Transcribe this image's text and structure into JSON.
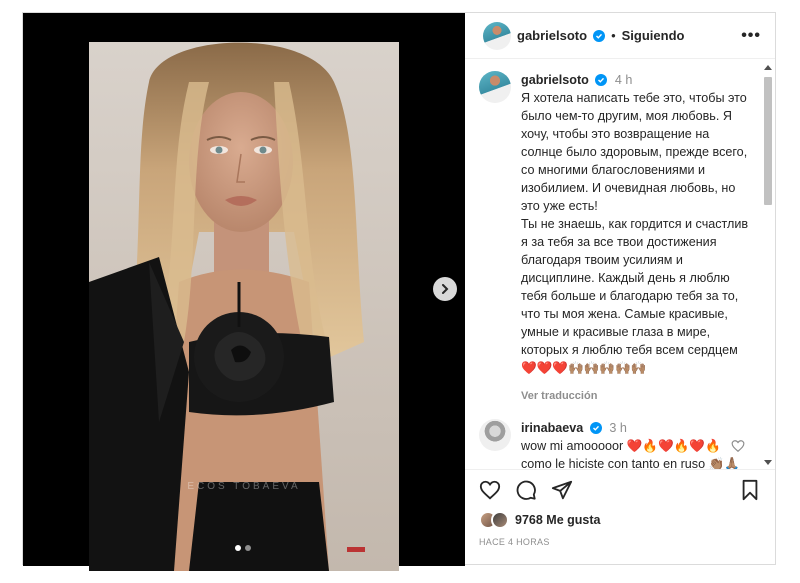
{
  "post": {
    "author": "gabrielsoto",
    "separator": "•",
    "follow_label": "Siguiendo",
    "more_label": "•••",
    "watermark": "ECOS  TOBAEVA"
  },
  "caption": {
    "user": "gabrielsoto",
    "time": "4 h",
    "text": "Я хотела написать тебе это, чтобы это было чем-то другим, моя любовь. Я хочу, чтобы это возвращение на солнце было здоровым, прежде всего, со многими благословениями и изобилием. И очевидная любовь, но это уже есть!\nТы не знаешь, как гордится и счастлив я за тебя за все твои достижения благодаря твоим усилиям и дисциплине. Каждый день я люблю тебя больше и благодарю тебя за то, что ты моя жена. Самые красивые, умные и красивые глаза в мире, которых я люблю тебя всем сердцем ❤️❤️❤️🙌🏽🙌🏽🙌🏽🙌🏽🙌🏽",
    "translate_label": "Ver traducción"
  },
  "comments": [
    {
      "user": "irinabaeva",
      "time": "3 h",
      "text": "wow mi amooooor ❤️🔥❤️🔥❤️🔥\ncomo le hiciste con tanto en ruso 👏🏽🙏🏽 te amo te amo te amo y no puedo estar más feliz y agradecida"
    }
  ],
  "stats": {
    "likes": "9768 Me gusta",
    "posted_ago": "HACE 4 HORAS"
  },
  "carousel": {
    "index": 1,
    "total": 2
  },
  "colors": {
    "verified": "#0095f6",
    "muted": "#8e8e8e",
    "text": "#262626"
  }
}
